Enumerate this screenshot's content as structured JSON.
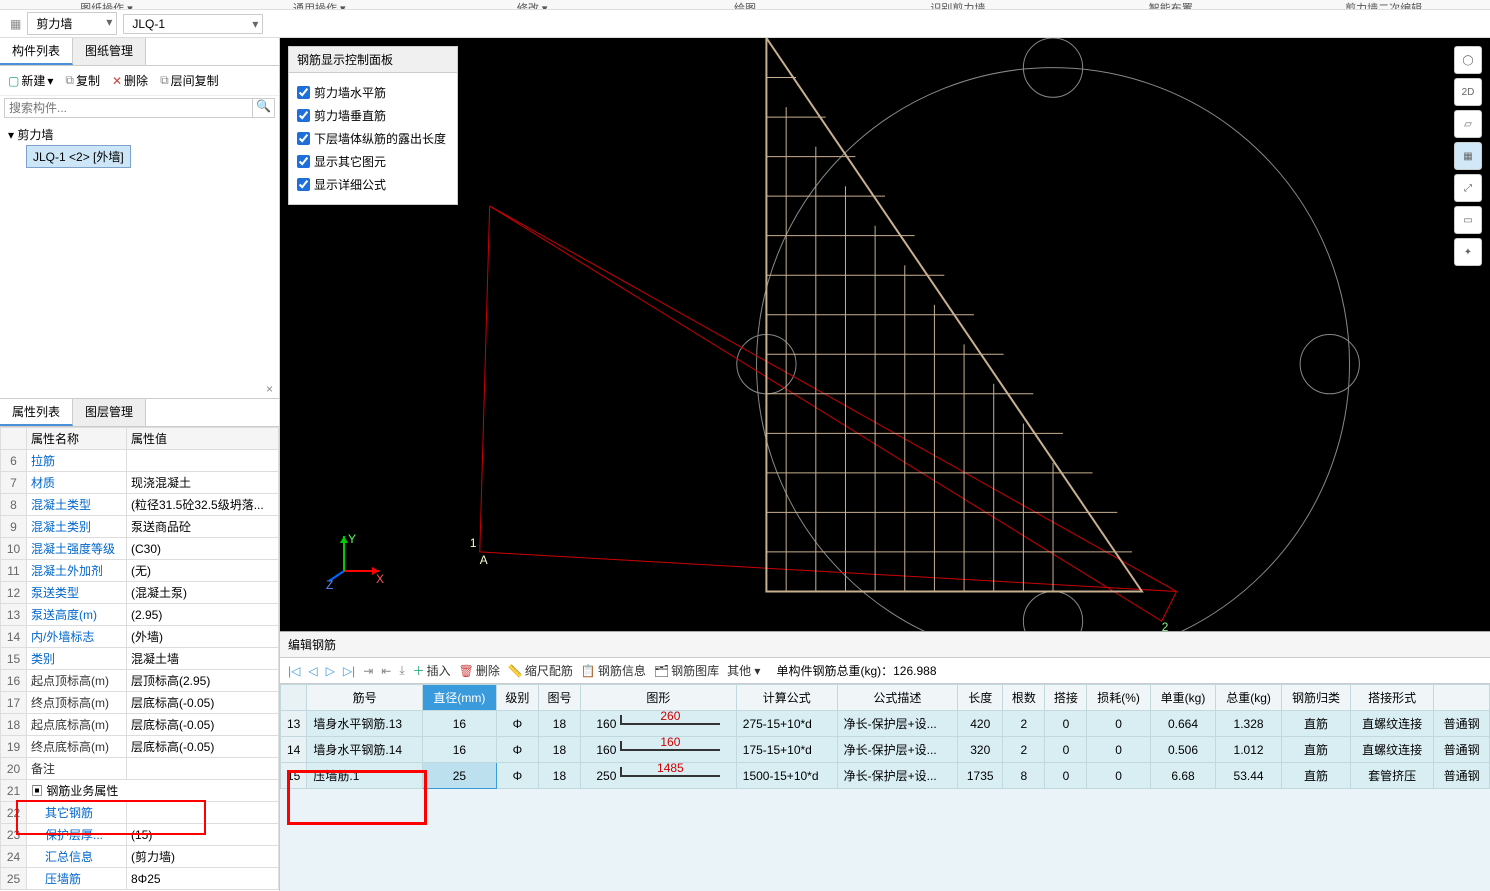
{
  "ribbon": [
    "图纸操作 ▾",
    "通用操作 ▾",
    "修改 ▾",
    "绘图",
    "识别剪力墙",
    "智能布置",
    "剪力墙二次编辑"
  ],
  "toolbar": {
    "dd1": "剪力墙",
    "dd2": "JLQ-1"
  },
  "leftTabs": {
    "t1": "构件列表",
    "t2": "图纸管理"
  },
  "leftToolbar": {
    "new": "新建",
    "copy": "复制",
    "del": "删除",
    "layercopy": "层间复制"
  },
  "search": {
    "placeholder": "搜索构件..."
  },
  "tree": {
    "root": "剪力墙",
    "child": "JLQ-1 <2> [外墙]"
  },
  "propTabs": {
    "t1": "属性列表",
    "t2": "图层管理"
  },
  "propHeaders": {
    "name": "属性名称",
    "value": "属性值"
  },
  "props": [
    {
      "n": "6",
      "name": "拉筋",
      "val": "",
      "blue": true
    },
    {
      "n": "7",
      "name": "材质",
      "val": "现浇混凝土",
      "blue": true
    },
    {
      "n": "8",
      "name": "混凝土类型",
      "val": "(粒径31.5砼32.5级坍落...",
      "blue": true
    },
    {
      "n": "9",
      "name": "混凝土类别",
      "val": "泵送商品砼",
      "blue": true
    },
    {
      "n": "10",
      "name": "混凝土强度等级",
      "val": "(C30)",
      "blue": true
    },
    {
      "n": "11",
      "name": "混凝土外加剂",
      "val": "(无)",
      "blue": true
    },
    {
      "n": "12",
      "name": "泵送类型",
      "val": "(混凝土泵)",
      "blue": true
    },
    {
      "n": "13",
      "name": "泵送高度(m)",
      "val": "(2.95)",
      "blue": true
    },
    {
      "n": "14",
      "name": "内/外墙标志",
      "val": "(外墙)",
      "blue": true
    },
    {
      "n": "15",
      "name": "类别",
      "val": "混凝土墙",
      "blue": true
    },
    {
      "n": "16",
      "name": "起点顶标高(m)",
      "val": "层顶标高(2.95)",
      "blue": false
    },
    {
      "n": "17",
      "name": "终点顶标高(m)",
      "val": "层底标高(-0.05)",
      "blue": false
    },
    {
      "n": "18",
      "name": "起点底标高(m)",
      "val": "层底标高(-0.05)",
      "blue": false
    },
    {
      "n": "19",
      "name": "终点底标高(m)",
      "val": "层底标高(-0.05)",
      "blue": false
    },
    {
      "n": "20",
      "name": "备注",
      "val": "",
      "blue": false
    }
  ],
  "propGroup": {
    "n": "21",
    "label": "钢筋业务属性"
  },
  "propTail": [
    {
      "n": "22",
      "name": "其它钢筋",
      "val": ""
    },
    {
      "n": "23",
      "name": "保护层厚...",
      "val": "(15)"
    },
    {
      "n": "24",
      "name": "汇总信息",
      "val": "(剪力墙)"
    },
    {
      "n": "25",
      "name": "压墙筋",
      "val": "8Φ25"
    }
  ],
  "floatPanel": {
    "title": "钢筋显示控制面板",
    "items": [
      "剪力墙水平筋",
      "剪力墙垂直筋",
      "下层墙体纵筋的露出长度",
      "显示其它图元",
      "显示详细公式"
    ]
  },
  "bottom": {
    "title": "编辑钢筋",
    "tools": {
      "insert": "插入",
      "del": "删除",
      "scale": "缩尺配筋",
      "info": "钢筋信息",
      "lib": "钢筋图库",
      "other": "其他 ▾"
    },
    "totalLabel": "单构件钢筋总重(kg)：",
    "totalVal": "126.988",
    "headers": [
      "筋号",
      "直径(mm)",
      "级别",
      "图号",
      "图形",
      "计算公式",
      "公式描述",
      "长度",
      "根数",
      "搭接",
      "损耗(%)",
      "单重(kg)",
      "总重(kg)",
      "钢筋归类",
      "搭接形式",
      ""
    ],
    "rows": [
      {
        "n": "13",
        "name": "墙身水平钢筋.13",
        "d": "16",
        "lv": "Φ",
        "pic": "18",
        "shapeL": "160",
        "shapeV": "260",
        "formula": "275-15+10*d",
        "desc": "净长-保护层+设...",
        "len": "420",
        "cnt": "2",
        "lap": "0",
        "loss": "0",
        "uw": "0.664",
        "tw": "1.328",
        "cat": "直筋",
        "form": "直螺纹连接",
        "ext": "普通钢"
      },
      {
        "n": "14",
        "name": "墙身水平钢筋.14",
        "d": "16",
        "lv": "Φ",
        "pic": "18",
        "shapeL": "160",
        "shapeV": "160",
        "formula": "175-15+10*d",
        "desc": "净长-保护层+设...",
        "len": "320",
        "cnt": "2",
        "lap": "0",
        "loss": "0",
        "uw": "0.506",
        "tw": "1.012",
        "cat": "直筋",
        "form": "直螺纹连接",
        "ext": "普通钢"
      },
      {
        "n": "15",
        "name": "压墙筋.1",
        "d": "25",
        "lv": "Φ",
        "pic": "18",
        "shapeL": "250",
        "shapeV": "1485",
        "formula": "1500-15+10*d",
        "desc": "净长-保护层+设...",
        "len": "1735",
        "cnt": "8",
        "lap": "0",
        "loss": "0",
        "uw": "6.68",
        "tw": "53.44",
        "cat": "直筋",
        "form": "套管挤压",
        "ext": "普通钢"
      }
    ]
  }
}
